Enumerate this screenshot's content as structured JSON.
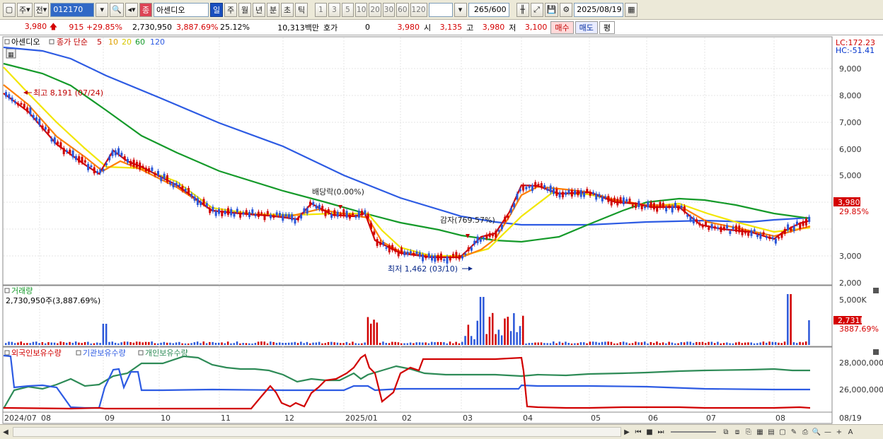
{
  "toolbar": {
    "period_label": "주",
    "prev_label": "전",
    "stock_code": "012170",
    "stock_type_label": "종",
    "stock_name": "아센디오",
    "periods": [
      "일",
      "주",
      "월",
      "년",
      "분",
      "초",
      "틱"
    ],
    "active_period_index": 0,
    "minute_options": [
      "1",
      "3",
      "5",
      "10",
      "20",
      "30",
      "60",
      "120"
    ],
    "count_value": "265",
    "count_total": "/600",
    "date_value": "2025/08/19"
  },
  "quote": {
    "price": "3,980",
    "change": "915",
    "change_rate": "+29.85%",
    "volume": "2,730,950",
    "volume_rate": "3,887.69%",
    "turnover": "25.12%",
    "amount": "10,313백만",
    "hoga_label": "호가",
    "hoga_value": "0",
    "ask_price": "3,980",
    "open_label": "시",
    "open_value": "3,135",
    "high_label": "고",
    "high_value": "3,980",
    "low_label": "저",
    "low_value": "3,100",
    "buy_label": "매수",
    "sell_label": "매도",
    "eval_label": "평"
  },
  "price_panel": {
    "legend_name": "아센디오",
    "legend_ma_label": "종가 단순",
    "ma_periods": [
      "5",
      "10",
      "20",
      "60",
      "120"
    ],
    "lc_label": "LC:172.23",
    "hc_label": "HC:-51.41",
    "y_ticks": [
      "9,000",
      "8,000",
      "7,000",
      "6,000",
      "5,000",
      "4,000",
      "3,000",
      "2,000"
    ],
    "current_price_tag": "3,980",
    "current_rate_tag": "29.85%",
    "annotations": {
      "high": "최고 8,191 (07/24)",
      "low": "최저 1,462 (03/10)",
      "dividend": "배당락(0.00%)",
      "capital_reduction": "감자(769.57%)"
    }
  },
  "volume_panel": {
    "title": "거래량",
    "value_line": "2,730,950주(3,887.69%)",
    "y_ticks": [
      "5,000K"
    ],
    "current_tag": "2,731K",
    "current_rate": "3887.69%"
  },
  "holding_panel": {
    "legend": [
      "외국인보유수량",
      "기관보유수량",
      "개인보유수량"
    ],
    "y_ticks": [
      "28,000,000",
      "26,000,000"
    ]
  },
  "x_axis": {
    "labels": [
      "2024/07",
      "08",
      "09",
      "10",
      "11",
      "12",
      "2025/01",
      "02",
      "03",
      "04",
      "05",
      "06",
      "07",
      "08",
      "08/19"
    ]
  },
  "colors": {
    "ma5": "#d10000",
    "ma10": "#ff7f00",
    "ma20": "#f2e600",
    "ma60": "#159a2a",
    "ma120": "#2d5be3",
    "candle_up": "#d10000",
    "candle_down": "#2b57d9",
    "foreign": "#d10000",
    "institution": "#2d5be3",
    "individual": "#2e8b57"
  }
}
